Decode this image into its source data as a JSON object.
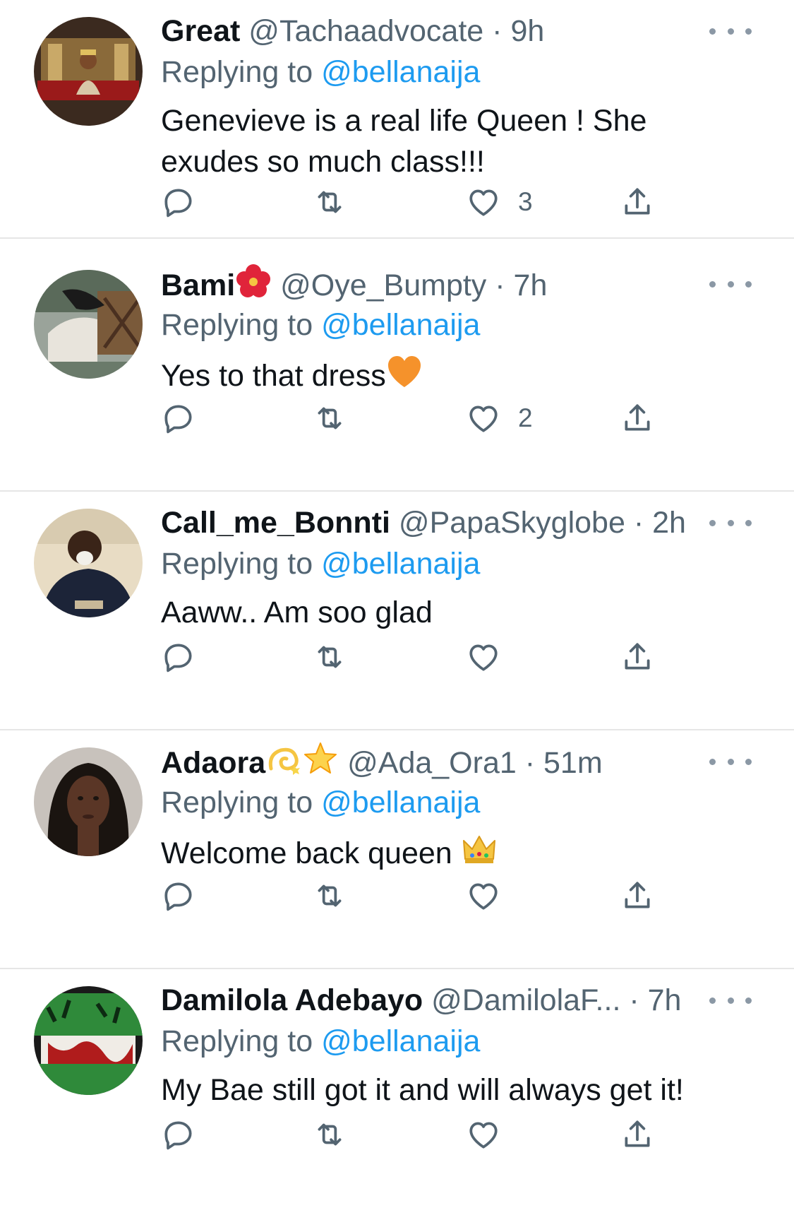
{
  "colors": {
    "link_blue": "#1d9bf0",
    "secondary_text": "#536471",
    "primary_text": "#0f1419",
    "divider": "#e6e6e6"
  },
  "tweets": [
    {
      "display_name": "Great",
      "name_emojis": [],
      "handle": "@Tachaadvocate",
      "separator": "·",
      "time": "9h",
      "replying_prefix": "Replying to",
      "replying_to": "@bellanaija",
      "text": "Genevieve is a real life Queen ! She exudes so much class!!!",
      "text_emoji": "",
      "like_count": "3",
      "avatar_icon": "avatar-royal-portrait"
    },
    {
      "display_name": "Bami",
      "name_emojis": [
        "hibiscus-emoji"
      ],
      "handle": "@Oye_Bumpty",
      "separator": "·",
      "time": "7h",
      "replying_prefix": "Replying to",
      "replying_to": "@bellanaija",
      "text": "Yes to that dress",
      "text_emoji": "orange-heart-emoji",
      "like_count": "2",
      "avatar_icon": "avatar-person-veranda"
    },
    {
      "display_name": "Call_me_Bonnti",
      "name_emojis": [],
      "handle": "@PapaSkyglobe",
      "separator": "·",
      "time": "2h",
      "replying_prefix": "Replying to",
      "replying_to": "@bellanaija",
      "text": "Aaww.. Am soo glad",
      "text_emoji": "",
      "like_count": "",
      "avatar_icon": "avatar-man-navy-shirt"
    },
    {
      "display_name": "Adaora",
      "name_emojis": [
        "dizzy-emoji",
        "glowing-star-emoji"
      ],
      "handle": "@Ada_Ora1",
      "separator": "·",
      "time": "51m",
      "replying_prefix": "Replying to",
      "replying_to": "@bellanaija",
      "text": "Welcome back queen",
      "text_emoji": "crown-emoji",
      "like_count": "",
      "avatar_icon": "avatar-woman-dark-hair"
    },
    {
      "display_name": "Damilola Adebayo",
      "name_emojis": [],
      "handle": "@DamilolaF...",
      "separator": "·",
      "time": "7h",
      "replying_prefix": "Replying to",
      "replying_to": "@bellanaija",
      "text": "My Bae still got it and will always get it!",
      "text_emoji": "",
      "like_count": "",
      "avatar_icon": "avatar-green-red-art"
    }
  ]
}
